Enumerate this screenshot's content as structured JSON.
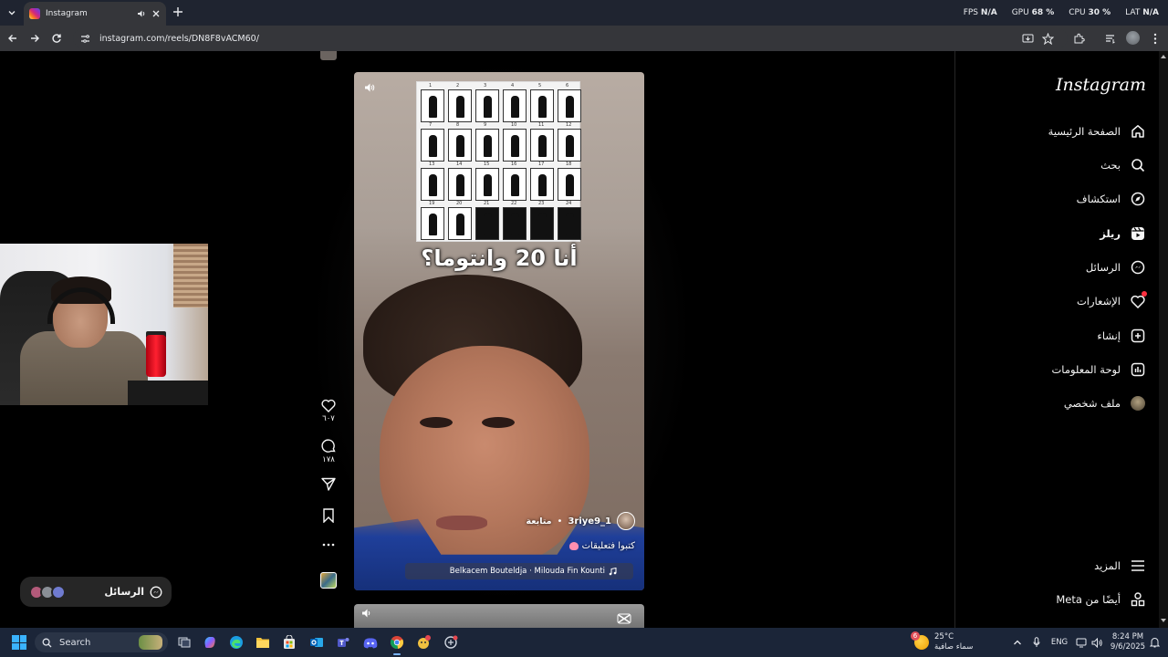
{
  "browser": {
    "tab_title": "Instagram",
    "url": "instagram.com/reels/DN8F8vACM60/",
    "perf": [
      {
        "label": "FPS",
        "value": "N/A"
      },
      {
        "label": "GPU",
        "value": "68 %"
      },
      {
        "label": "CPU",
        "value": "30 %"
      },
      {
        "label": "LAT",
        "value": "N/A"
      }
    ]
  },
  "sidebar": {
    "logo": "Instagram",
    "items": [
      {
        "label": "الصفحة الرئيسية",
        "icon": "home-icon"
      },
      {
        "label": "بحث",
        "icon": "search-icon"
      },
      {
        "label": "استكشاف",
        "icon": "compass-icon"
      },
      {
        "label": "ريلز",
        "icon": "reels-icon"
      },
      {
        "label": "الرسائل",
        "icon": "messenger-icon"
      },
      {
        "label": "الإشعارات",
        "icon": "heart-icon"
      },
      {
        "label": "إنشاء",
        "icon": "plus-square-icon"
      },
      {
        "label": "لوحة المعلومات",
        "icon": "dashboard-icon"
      },
      {
        "label": "ملف شخصي",
        "icon": "profile-avatar"
      }
    ],
    "more_label": "المزيد",
    "also_from_meta": "أيضًا من Meta"
  },
  "reel": {
    "overlay_text": "أنا 20 وانتوما؟",
    "poster_numbers": [
      "1",
      "2",
      "3",
      "4",
      "5",
      "6",
      "7",
      "8",
      "9",
      "10",
      "11",
      "12",
      "13",
      "14",
      "15",
      "16",
      "17",
      "18",
      "19",
      "20",
      "21",
      "22",
      "23",
      "24"
    ],
    "author": "3riye9_1",
    "follow_label": "متابعة",
    "caption": "كتبوا فتعليقات",
    "audio": "Belkacem Bouteldja · Milouda Fin Kounti",
    "likes": "٦٠٧",
    "comments": "١٧٨"
  },
  "messages_pill": {
    "label": "الرسائل",
    "avatar_colors": [
      "#b35a7a",
      "#8a8f96",
      "#6f7bd0"
    ]
  },
  "taskbar": {
    "search_placeholder": "Search",
    "weather_temp": "25°C",
    "weather_desc": "سماء صافية",
    "weather_badge": "6",
    "language": "ENG",
    "time": "8:24 PM",
    "date": "9/6/2025",
    "apps": [
      "file-explorer-icon",
      "copilot-icon",
      "edge-icon",
      "folder-icon",
      "store-icon",
      "outlook-icon",
      "teams-icon",
      "discord-icon",
      "chrome-icon",
      "app-badge-icon",
      "network-app-icon"
    ]
  },
  "colors": {
    "background": "#000000",
    "chrome_bg": "#35363a",
    "taskbar_bg": "#1b2538",
    "notification_dot": "#ff3040",
    "accent": "#7ab4ff"
  }
}
